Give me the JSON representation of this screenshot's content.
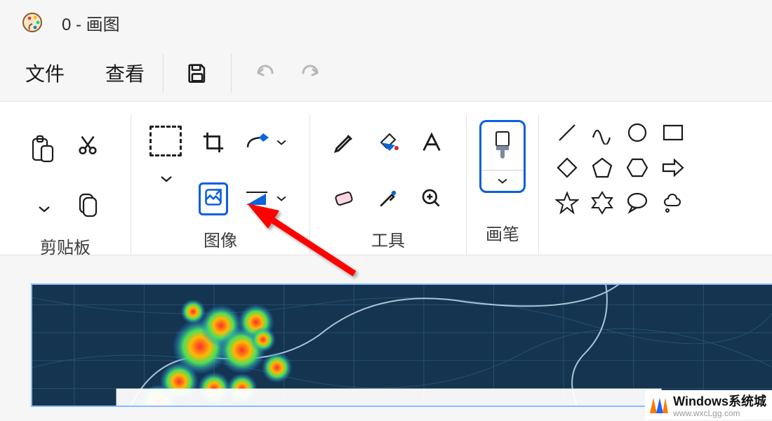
{
  "titlebar": {
    "title": "0 - 画图"
  },
  "menubar": {
    "file": "文件",
    "view": "查看"
  },
  "ribbon": {
    "clipboard": {
      "label": "剪贴板"
    },
    "image": {
      "label": "图像"
    },
    "tools": {
      "label": "工具"
    },
    "brush": {
      "label": "画笔"
    }
  },
  "watermark": {
    "title": "Windows系统城",
    "sub": "www.wxcLgg.com"
  }
}
